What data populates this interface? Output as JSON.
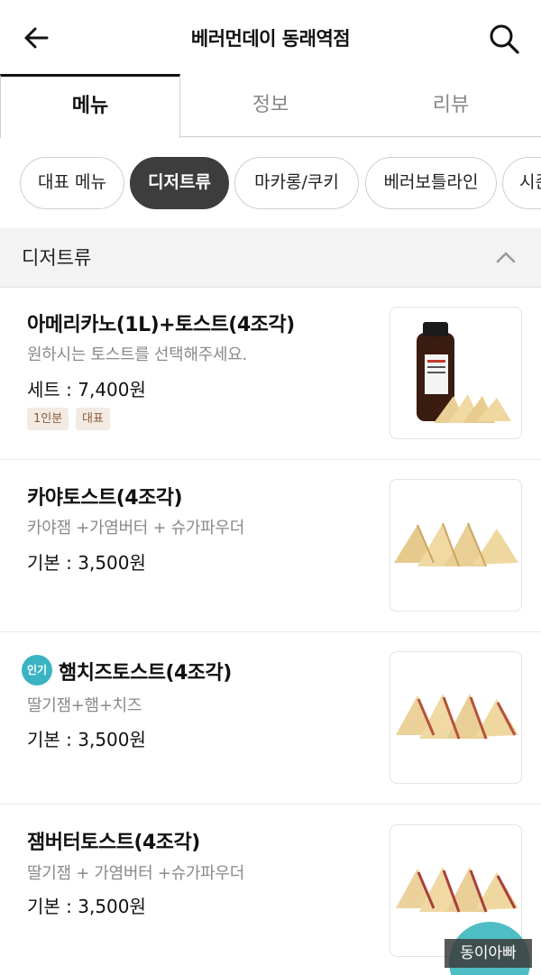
{
  "header": {
    "title": "베러먼데이 동래역점",
    "back_icon": "arrow-left-icon",
    "search_icon": "search-icon"
  },
  "tabs": [
    {
      "label": "메뉴",
      "active": true
    },
    {
      "label": "정보",
      "active": false
    },
    {
      "label": "리뷰",
      "active": false
    }
  ],
  "categories": [
    {
      "label": "대표 메뉴",
      "active": false
    },
    {
      "label": "디저트류",
      "active": true
    },
    {
      "label": "마카롱/쿠키",
      "active": false
    },
    {
      "label": "베러보틀라인",
      "active": false
    },
    {
      "label": "시즌",
      "active": false
    }
  ],
  "section": {
    "title": "디저트류",
    "collapse_icon": "chevron-up-icon"
  },
  "menu_items": [
    {
      "name": "아메리카노(1L)+토스트(4조각)",
      "description": "원하시는 토스트를 선택해주세요.",
      "price": "세트 : 7,400원",
      "tags": [
        "1인분",
        "대표"
      ],
      "image": "americano-bottle-toast-image"
    },
    {
      "name": "카야토스트(4조각)",
      "description": "카야잼 +가염버터 + 슈가파우더",
      "price": "기본 : 3,500원",
      "image": "kaya-toast-image"
    },
    {
      "name": "햄치즈토스트(4조각)",
      "badge": "인기",
      "description": "딸기잼+햄+치즈",
      "price": "기본 : 3,500원",
      "image": "ham-cheese-toast-image"
    },
    {
      "name": "잼버터토스트(4조각)",
      "description": "딸기잼 +  가염버터  +슈가파우더",
      "price": "기본 : 3,500원",
      "image": "jam-butter-toast-image"
    }
  ],
  "watermark": "동이아빠",
  "colors": {
    "active_chip": "#3d3d3d",
    "tag_bg": "#f3ebe3",
    "tag_text": "#8b5a3a",
    "popular_badge": "#3bb3c3",
    "fab": "#4fbdc4"
  }
}
